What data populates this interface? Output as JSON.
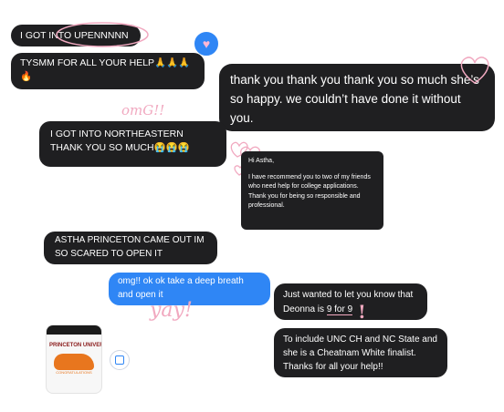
{
  "messages": {
    "m1": "I GOT INTO UPENNNNN",
    "m2a": "TYSMM FOR ALL YOUR HELP🙏🙏🙏",
    "m2b": "🔥",
    "m3": "thank you thank you thank you so much she’s so happy. we couldn’t have done it without you.",
    "m4": "I GOT INTO NORTHEASTERN THANK YOU SO MUCH😭😭😭",
    "m5_greeting": "Hi Astha,",
    "m5_body": "I have recommend you to two of my friends who need help for college applications. Thank you for being so responsible and professional.",
    "m6": "ASTHA PRINCETON CAME OUT IM SO SCARED TO OPEN IT",
    "m7": "omg!! ok ok take a deep breath and open it",
    "m8_prefix": "Just wanted to let you know that Deonna is ",
    "m8_highlight": "9 for 9",
    "m9": "To include UNC CH and NC State and she is a Cheatnam White finalist. Thanks for all your help!!"
  },
  "decorations": {
    "omg": "omG!!",
    "yay": "yay!",
    "exclaim": "!"
  },
  "attachment": {
    "logo": "PRINCETON UNIVERSITY",
    "caption": "CONGRATULATIONS"
  },
  "colors": {
    "dark_bubble": "#1f1f21",
    "blue_bubble": "#2f86f5",
    "accent_pink": "#f1a9c0",
    "reaction_heart": "#2f86f5"
  }
}
